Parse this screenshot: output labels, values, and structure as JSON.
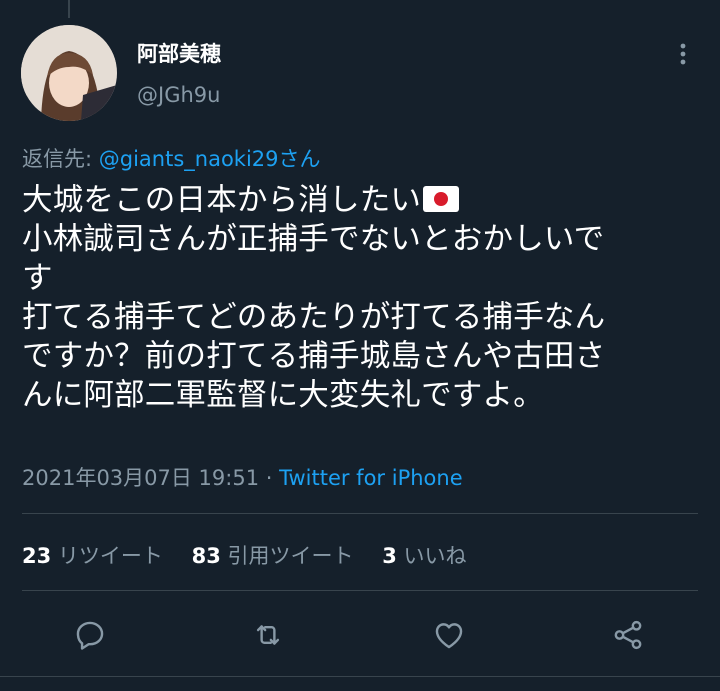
{
  "user": {
    "display_name": "阿部美穂",
    "handle": "@JGh9u"
  },
  "reply": {
    "prefix": "返信先: ",
    "mention": "@giants_naoki29さん"
  },
  "tweet": {
    "lines": [
      "大城をこの日本から消したい",
      "小林誠司さんが正捕手でないとおかしいで",
      "す",
      "打てる捕手てどのあたりが打てる捕手なん",
      "ですか？前の打てる捕手城島さんや古田さ",
      "んに阿部二軍監督に大変失礼ですよ。"
    ],
    "emoji": "flag-japan"
  },
  "meta": {
    "timestamp": "2021年03月07日 19:51",
    "separator": " · ",
    "source": "Twitter for iPhone"
  },
  "stats": {
    "retweets_count": "23",
    "retweets_label": " リツイート",
    "quotes_count": "83",
    "quotes_label": " 引用ツイート",
    "likes_count": "3",
    "likes_label": " いいね"
  },
  "colors": {
    "background": "#15202b",
    "secondary_text": "#8899a6",
    "link": "#1da1f2",
    "divider": "#38444d"
  },
  "icons": [
    "more-vertical-icon",
    "reply-icon",
    "retweet-icon",
    "like-icon",
    "share-icon"
  ]
}
